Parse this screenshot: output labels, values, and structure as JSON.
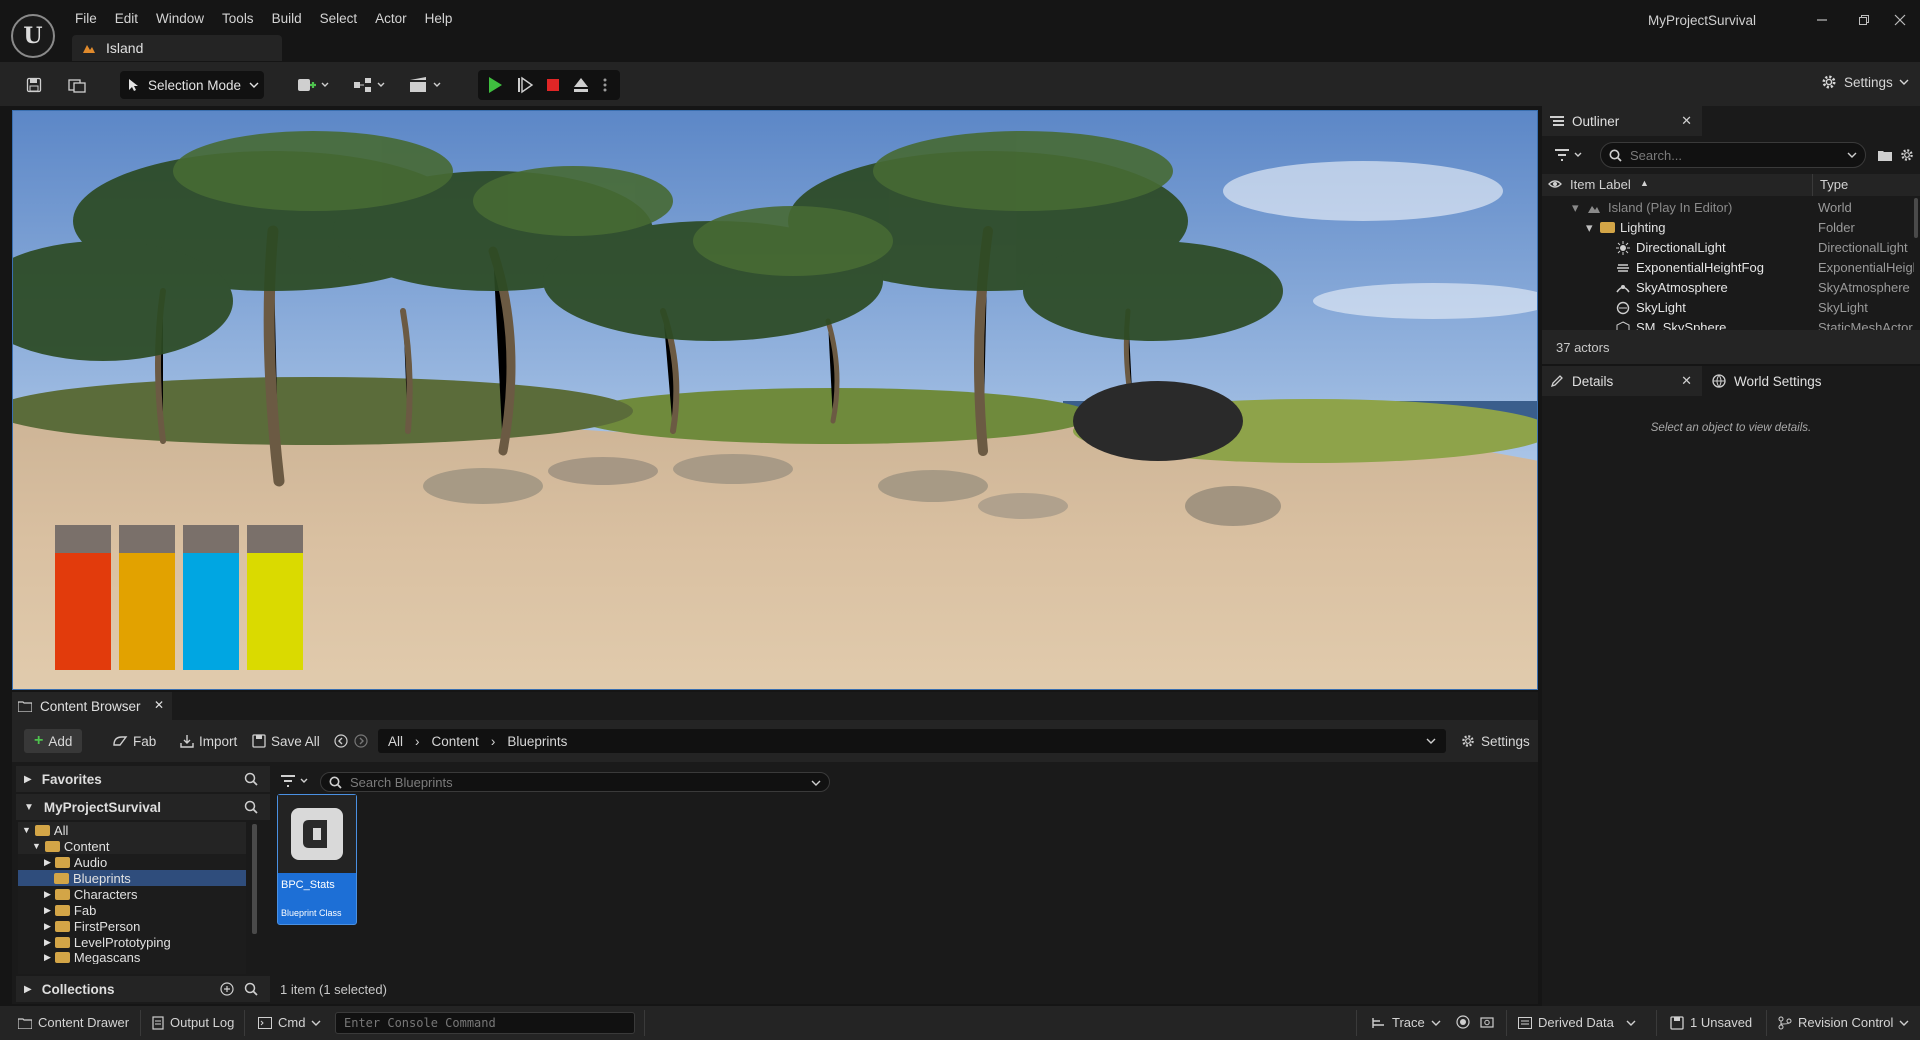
{
  "menu": [
    "File",
    "Edit",
    "Window",
    "Tools",
    "Build",
    "Select",
    "Actor",
    "Help"
  ],
  "level_tab": "Island",
  "app_title": "MyProjectSurvival",
  "toolbar": {
    "selection_mode": "Selection Mode",
    "settings": "Settings"
  },
  "stat_bars": [
    {
      "color": "#e23b0c",
      "fill": 0.81
    },
    {
      "color": "#e2a200",
      "fill": 0.81
    },
    {
      "color": "#00a6e2",
      "fill": 0.81
    },
    {
      "color": "#dada00",
      "fill": 0.81
    }
  ],
  "outliner": {
    "tab": "Outliner",
    "search_placeholder": "Search...",
    "col_label": "Item Label",
    "col_type": "Type",
    "rows": [
      {
        "label": "Island (Play In Editor)",
        "type": "World"
      },
      {
        "label": "Lighting",
        "type": "Folder"
      },
      {
        "label": "DirectionalLight",
        "type": "DirectionalLight"
      },
      {
        "label": "ExponentialHeightFog",
        "type": "ExponentialHeightFog"
      },
      {
        "label": "SkyAtmosphere",
        "type": "SkyAtmosphere"
      },
      {
        "label": "SkyLight",
        "type": "SkyLight"
      },
      {
        "label": "SM_SkySphere",
        "type": "StaticMeshActor"
      }
    ],
    "count": "37 actors"
  },
  "details": {
    "tab": "Details",
    "tab2": "World Settings",
    "empty": "Select an object to view details."
  },
  "content_browser": {
    "tab": "Content Browser",
    "add": "Add",
    "fab": "Fab",
    "import": "Import",
    "save_all": "Save All",
    "path": [
      "All",
      "Content",
      "Blueprints"
    ],
    "settings": "Settings",
    "favorites": "Favorites",
    "project": "MyProjectSurvival",
    "tree": [
      "All",
      "Content",
      "Audio",
      "Blueprints",
      "Characters",
      "Fab",
      "FirstPerson",
      "LevelPrototyping",
      "Megascans"
    ],
    "collections": "Collections",
    "search_placeholder": "Search Blueprints",
    "asset_name": "BPC_Stats",
    "asset_type": "Blueprint Class",
    "status": "1 item (1 selected)"
  },
  "statusbar": {
    "content_drawer": "Content Drawer",
    "output_log": "Output Log",
    "cmd": "Cmd",
    "console_placeholder": "Enter Console Command",
    "trace": "Trace",
    "derived_data": "Derived Data",
    "unsaved": "1 Unsaved",
    "revision": "Revision Control"
  }
}
